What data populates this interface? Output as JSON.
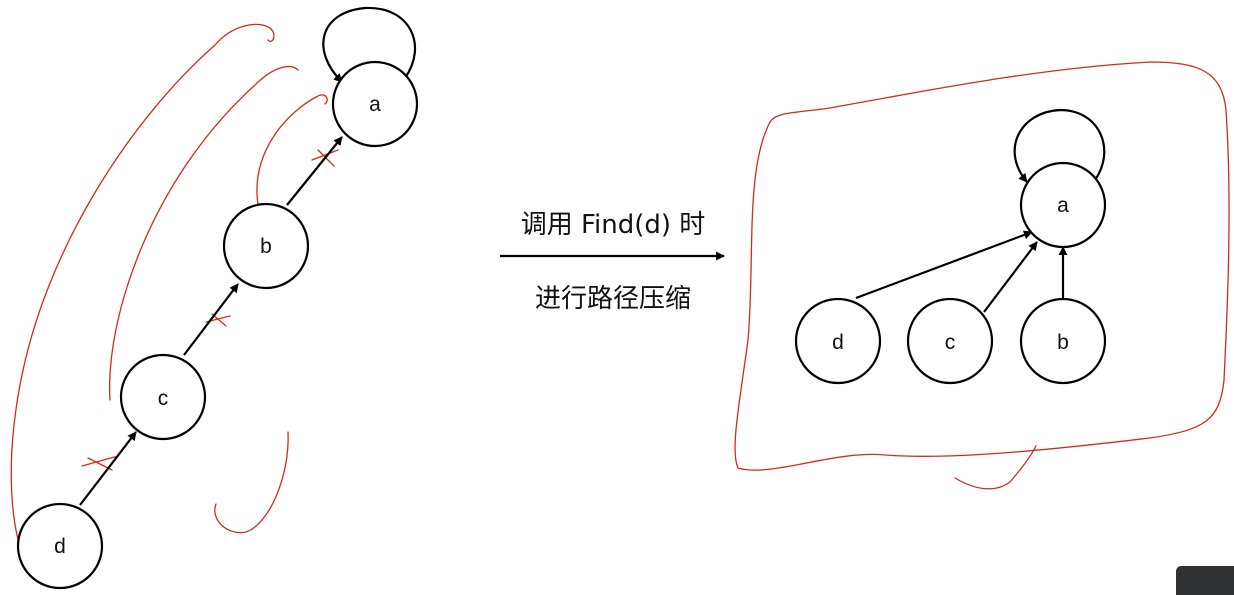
{
  "colors": {
    "node_stroke": "#000000",
    "annotation": "#d42a1e",
    "text": "#111111"
  },
  "caption": {
    "line1": "调用 Find(d) 时",
    "line2": "进行路径压缩"
  },
  "before": {
    "nodes": {
      "a": "a",
      "b": "b",
      "c": "c",
      "d": "d"
    }
  },
  "after": {
    "nodes": {
      "a": "a",
      "b": "b",
      "c": "c",
      "d": "d"
    }
  }
}
